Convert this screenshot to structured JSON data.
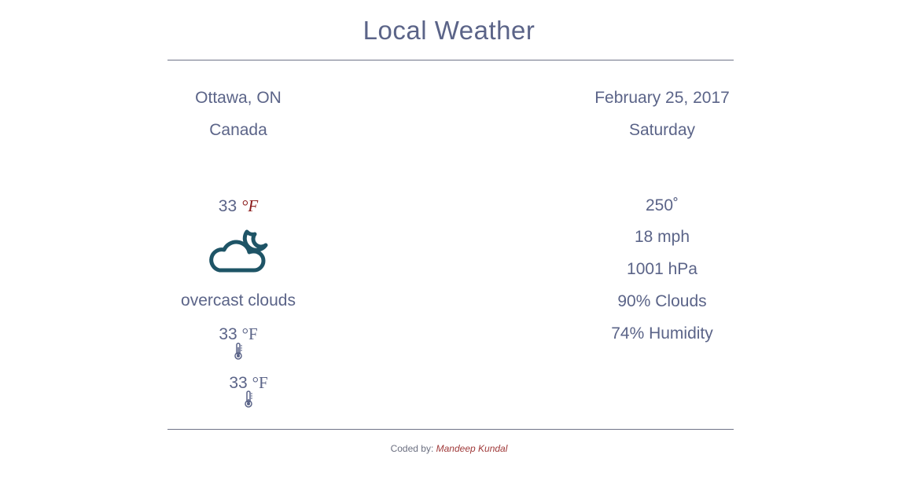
{
  "page": {
    "title": "Local Weather"
  },
  "location": {
    "city": "Ottawa, ON",
    "country": "Canada"
  },
  "date": {
    "full": "February 25, 2017",
    "weekday": "Saturday"
  },
  "current": {
    "temp_value": "33",
    "temp_unit": "°F",
    "icon": "cloud-moon-icon",
    "description": "overcast clouds",
    "max_temp_value": "33",
    "max_temp_unit": "°F",
    "min_temp_value": "33",
    "min_temp_unit": "°F"
  },
  "details": {
    "wind_direction": "250˚",
    "wind_speed": "18 mph",
    "pressure": "1001 hPa",
    "clouds": "90% Clouds",
    "humidity": "74% Humidity"
  },
  "footer": {
    "prefix": "Coded by: ",
    "author": "Mandeep Kundal"
  },
  "colors": {
    "text": "#5b6488",
    "accent": "#8b1a1a",
    "icon": "#1e5466"
  }
}
